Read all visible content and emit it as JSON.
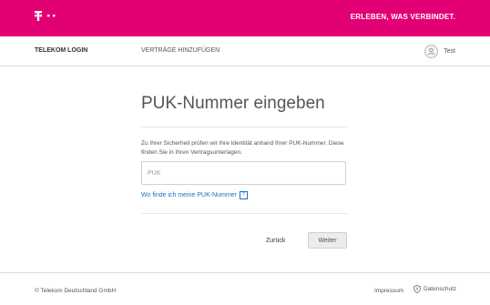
{
  "brand": {
    "logo": "telekom-t-logo",
    "slogan": "ERLEBEN, WAS VERBINDET.",
    "color": "#e20074"
  },
  "nav": {
    "login": "TELEKOM LOGIN",
    "add_contracts": "VERTRÄGE HINZUFÜGEN",
    "user_name": "Test",
    "user_icon": "user-icon"
  },
  "main": {
    "title": "PUK-Nummer eingeben",
    "info": "Zu Ihrer Sicherheit prüfen wir Ihre Identität anhand Ihrer PUK-Nummer. Diese finden Sie in Ihren Vertragsunterlagen.",
    "puk": {
      "placeholder": "PUK",
      "value": ""
    },
    "help_link": "Wo finde ich meine PUK-Nummer",
    "help_icon": "?",
    "back": "Zurück",
    "next": "Weiter"
  },
  "footer": {
    "copyright": "© Telekom Deutschland GmbH",
    "impressum": "Impressum",
    "privacy": "Datenschutz",
    "privacy_icon": "shield-icon"
  }
}
